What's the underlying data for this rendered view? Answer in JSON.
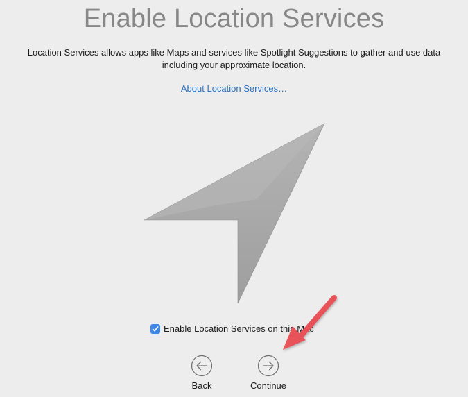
{
  "page": {
    "title": "Enable Location Services",
    "description": "Location Services allows apps like Maps and services like Spotlight Suggestions to gather and use data including your approximate location.",
    "about_link": "About Location Services…"
  },
  "illustration": {
    "icon": "location-arrow-icon"
  },
  "checkbox": {
    "label": "Enable Location Services on this Mac",
    "checked": true
  },
  "navigation": {
    "back": {
      "label": "Back",
      "icon": "arrow-left-circle-icon"
    },
    "continue": {
      "label": "Continue",
      "icon": "arrow-right-circle-icon"
    }
  },
  "annotation": {
    "type": "red-arrow",
    "points_to": "continue",
    "color": "#e8525a"
  },
  "colors": {
    "background": "#ededed",
    "title": "#878787",
    "link": "#2c72c0",
    "checkbox": "#3b87e8"
  }
}
